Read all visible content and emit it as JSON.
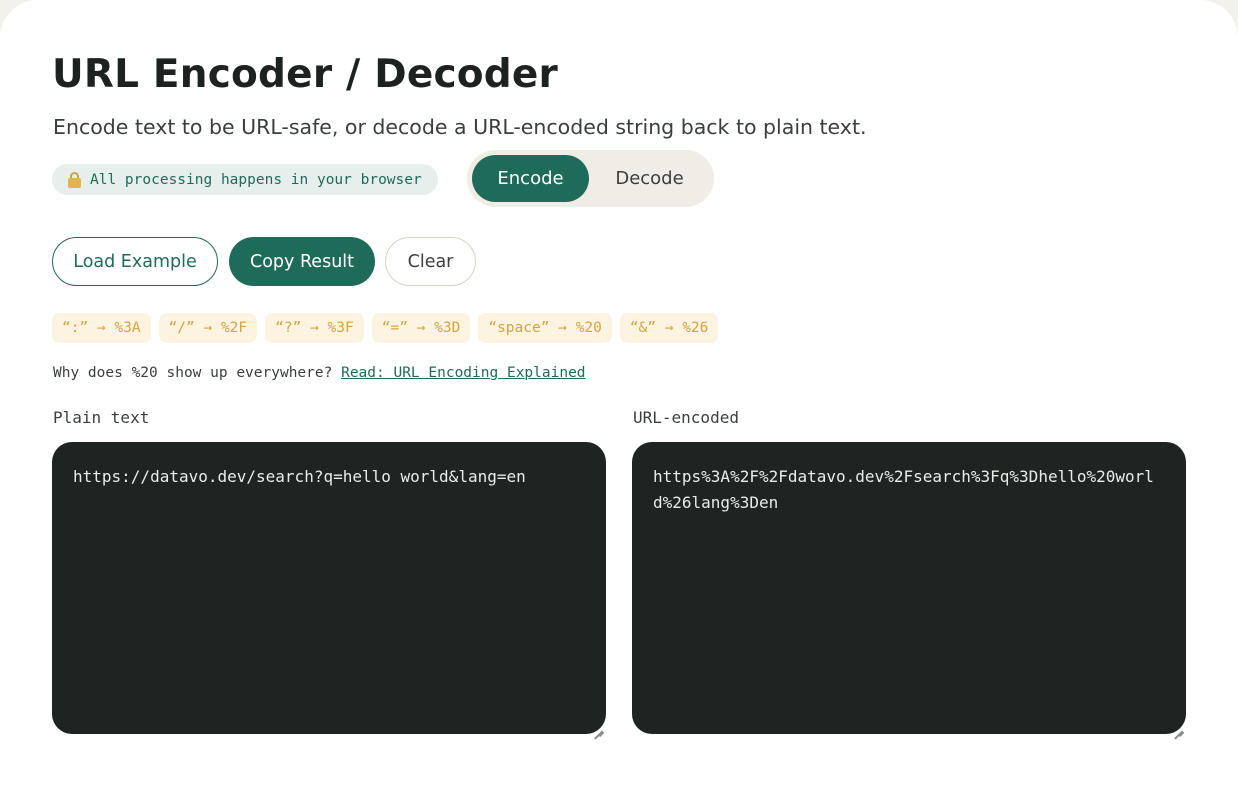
{
  "header": {
    "title": "URL Encoder / Decoder",
    "subtitle": "Encode text to be URL-safe, or decode a URL-encoded string back to plain text."
  },
  "privacy_badge": {
    "icon": "lock-icon",
    "text": "All processing happens in your browser"
  },
  "mode_toggle": {
    "options": [
      "Encode",
      "Decode"
    ],
    "selected": "Encode"
  },
  "actions": {
    "load_example": "Load Example",
    "copy_result": "Copy Result",
    "clear": "Clear"
  },
  "reference_chips": [
    "“:” → %3A",
    "“/” → %2F",
    "“?” → %3F",
    "“=” → %3D",
    "“space” → %20",
    "“&” → %26"
  ],
  "help": {
    "question": "Why does %20 show up everywhere?",
    "link_text": "Read: URL Encoding Explained"
  },
  "panes": {
    "plain_label": "Plain text",
    "plain_value": "https://datavo.dev/search?q=hello world&lang=en",
    "encoded_label": "URL-encoded",
    "encoded_value": "https%3A%2F%2Fdatavo.dev%2Fsearch%3Fq%3Dhello%20world%26lang%3Den"
  },
  "colors": {
    "accent": "#1f6b5a",
    "pane_background": "#1f2322",
    "chip_background": "#fdf3e1",
    "chip_text": "#d9a441"
  }
}
